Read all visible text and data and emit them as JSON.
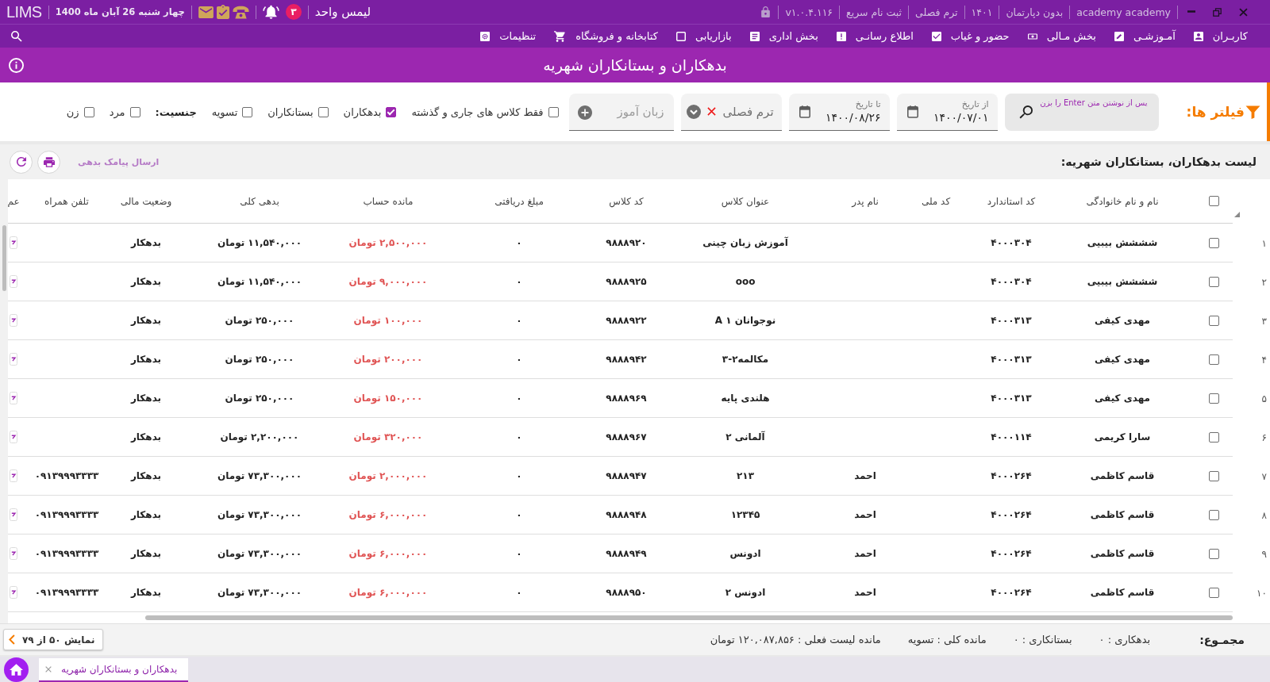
{
  "top_bar": {
    "logo": "LIMS",
    "date": "چهار شنبه 26 آبان ماه 1400",
    "notification_count": "۳",
    "unit": "لیمس واحد",
    "info_items": [
      "academy academy",
      "بدون دپارتمان",
      "۱۴۰۱",
      "ترم فصلی",
      "ثبت نام سریع",
      "v۱.۰.۴.۱۱۶"
    ]
  },
  "nav_menu": [
    "کاربـران",
    "آمـوزشـی",
    "بخش مـالی",
    "حضور و غیاب",
    "اطلاع رسانـی",
    "بخش اداری",
    "بازاریابی",
    "کتابخانه و فروشگاه",
    "تنظیمات"
  ],
  "page_title": "بدهکاران و بستانکاران شهریه",
  "filters": {
    "title": "فیلتر ها:",
    "search": {
      "placeholder": "پس از نوشتن متن Enter را بزن"
    },
    "date_from": {
      "label": "از تاریخ",
      "value": "۱۴۰۰/۰۷/۰۱"
    },
    "date_to": {
      "label": "تا تاریخ",
      "value": "۱۴۰۰/۰۸/۲۶"
    },
    "term": {
      "value": "ترم فصلی"
    },
    "student": {
      "placeholder": "زبان آموز"
    },
    "options": [
      {
        "label": "فقط کلاس های جاری و گذشته",
        "checked": false
      },
      {
        "label": "بدهکاران",
        "checked": true
      },
      {
        "label": "بستانکاران",
        "checked": false
      },
      {
        "label": "تسویه",
        "checked": false
      }
    ],
    "gender": {
      "label": "جنسیت:",
      "options": [
        {
          "label": "مرد",
          "checked": false
        },
        {
          "label": "زن",
          "checked": false
        }
      ]
    }
  },
  "list_header": {
    "title": "لیست بدهکاران، بستانکاران شهریه:",
    "sms_button": {
      "label": "ارسال پیامک بدهی",
      "disabled": true
    }
  },
  "table": {
    "header_checkbox": {
      "checked": false
    },
    "columns": [
      "نام و نام خانوادگی",
      "کد استاندارد",
      "کد ملی",
      "نام پدر",
      "عنوان کلاس",
      "کد کلاس",
      "مبلغ دریافتی",
      "مانده حساب",
      "بدهی کلی",
      "وضعیت مالی",
      "تلفن همراه",
      "عم"
    ],
    "rows": [
      {
        "number": "۱",
        "checked": false,
        "name": "شششش بیبیی",
        "standard_code": "۴۰۰۰۳۰۴",
        "class_title": "آموزش زبان چینی",
        "class_code": "۹۸۸۸۹۲۰",
        "received": "۰",
        "balance": "۲,۵۰۰,۰۰۰ تومان",
        "total_debt": "۱۱,۵۴۰,۰۰۰ تومان",
        "status": "بدهکار"
      },
      {
        "number": "۲",
        "checked": false,
        "name": "شششش بیبیی",
        "standard_code": "۴۰۰۰۳۰۴",
        "class_title": "ooo",
        "class_code": "۹۸۸۸۹۲۵",
        "received": "۰",
        "balance": "۹,۰۰۰,۰۰۰ تومان",
        "total_debt": "۱۱,۵۴۰,۰۰۰ تومان",
        "status": "بدهکار"
      },
      {
        "number": "۳",
        "checked": false,
        "name": "مهدی کیفی",
        "standard_code": "۴۰۰۰۳۱۳",
        "class_title": "نوجوانان ۱ A",
        "class_code": "۹۸۸۸۹۲۲",
        "received": "۰",
        "balance": "۱۰۰,۰۰۰ تومان",
        "total_debt": "۲۵۰,۰۰۰ تومان",
        "status": "بدهکار"
      },
      {
        "number": "۴",
        "checked": false,
        "name": "مهدی کیفی",
        "standard_code": "۴۰۰۰۳۱۳",
        "class_title": "مکالمه۲-۳",
        "class_code": "۹۸۸۸۹۴۲",
        "received": "۰",
        "balance": "۲۰۰,۰۰۰ تومان",
        "total_debt": "۲۵۰,۰۰۰ تومان",
        "status": "بدهکار"
      },
      {
        "number": "۵",
        "checked": false,
        "name": "مهدی کیفی",
        "standard_code": "۴۰۰۰۳۱۳",
        "class_title": "هلندی پایه",
        "class_code": "۹۸۸۸۹۶۹",
        "received": "۰",
        "balance": "۱۵۰,۰۰۰ تومان",
        "total_debt": "۲۵۰,۰۰۰ تومان",
        "status": "بدهکار"
      },
      {
        "number": "۶",
        "checked": false,
        "name": "سارا کریمی",
        "standard_code": "۴۰۰۰۱۱۴",
        "class_title": "آلمانی ۲",
        "class_code": "۹۸۸۸۹۶۷",
        "received": "۰",
        "balance": "۳۲۰,۰۰۰ تومان",
        "total_debt": "۲,۲۰۰,۰۰۰ تومان",
        "status": "بدهکار"
      },
      {
        "number": "۷",
        "checked": false,
        "name": "قاسم کاظمی",
        "standard_code": "۴۰۰۰۲۶۴",
        "father_name": "احمد",
        "class_title": "۲۱۳",
        "class_code": "۹۸۸۸۹۴۷",
        "received": "۰",
        "balance": "۲,۰۰۰,۰۰۰ تومان",
        "total_debt": "۷۳,۳۰۰,۰۰۰ تومان",
        "status": "بدهکار",
        "mobile": "۰۹۱۳۹۹۹۳۳۳۳"
      },
      {
        "number": "۸",
        "checked": false,
        "name": "قاسم کاظمی",
        "standard_code": "۴۰۰۰۲۶۴",
        "father_name": "احمد",
        "class_title": "۱۲۳۴۵",
        "class_code": "۹۸۸۸۹۴۸",
        "received": "۰",
        "balance": "۶,۰۰۰,۰۰۰ تومان",
        "total_debt": "۷۳,۳۰۰,۰۰۰ تومان",
        "status": "بدهکار",
        "mobile": "۰۹۱۳۹۹۹۳۳۳۳"
      },
      {
        "number": "۹",
        "checked": false,
        "name": "قاسم کاظمی",
        "standard_code": "۴۰۰۰۲۶۴",
        "father_name": "احمد",
        "class_title": "ادونس",
        "class_code": "۹۸۸۸۹۴۹",
        "received": "۰",
        "balance": "۶,۰۰۰,۰۰۰ تومان",
        "total_debt": "۷۳,۳۰۰,۰۰۰ تومان",
        "status": "بدهکار",
        "mobile": "۰۹۱۳۹۹۹۳۳۳۳"
      },
      {
        "number": "۱۰",
        "checked": false,
        "name": "قاسم کاظمی",
        "standard_code": "۴۰۰۰۲۶۴",
        "father_name": "احمد",
        "class_title": "ادونس ۲",
        "class_code": "۹۸۸۸۹۵۰",
        "received": "۰",
        "balance": "۶,۰۰۰,۰۰۰ تومان",
        "total_debt": "۷۳,۳۰۰,۰۰۰ تومان",
        "status": "بدهکار",
        "mobile": "۰۹۱۳۹۹۹۳۳۳۳"
      }
    ]
  },
  "summary": {
    "label": "مجمـوع:",
    "items": [
      "بدهکاری : ۰",
      "بستانکاری : ۰",
      "مانده کلی : تسویه",
      "مانده لیست فعلی : ۱۲۰,۰۸۷,۸۵۶ تومان"
    ],
    "pager_button": "نمایش ۵۰ از ۷۹"
  },
  "tabs": [
    {
      "label": "بدهکاران و بستانکاران شهریه",
      "selected": true
    }
  ]
}
